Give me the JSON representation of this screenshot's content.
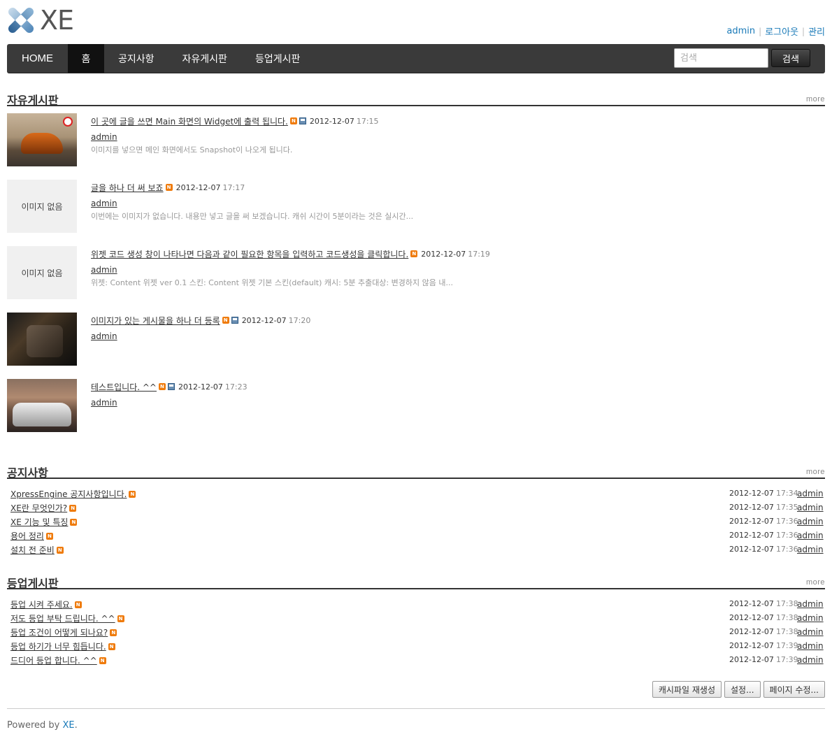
{
  "logo": {
    "text": "XE"
  },
  "account": {
    "admin": "admin",
    "logout": "로그아웃",
    "manage": "관리"
  },
  "gnb": {
    "items": [
      "HOME",
      "홈",
      "공지사항",
      "자유게시판",
      "등업게시판"
    ],
    "search_placeholder": "검색",
    "search_button": "검색"
  },
  "free_board": {
    "title": "자유게시판",
    "more": "more",
    "no_image": "이미지 없음",
    "items": [
      {
        "title": "이 곳에 글을 쓰면 Main 화면의 Widget에 출력 됩니다.",
        "date": "2012-12-07",
        "time": "17:15",
        "author": "admin",
        "summary": "이미지를 넣으면 메인 화면에서도 Snapshot이 나오게 됩니다."
      },
      {
        "title": "글을 하나 더 써 보죠",
        "date": "2012-12-07",
        "time": "17:17",
        "author": "admin",
        "summary": "이번에는 이미지가 없습니다. 내용만 넣고 글을 써 보겠습니다. 캐쉬 시간이 5분이라는 것은 실시간..."
      },
      {
        "title": "위젯 코드 생성 창이 나타나면 다음과 같이 필요한 항목을 입력하고 코드생성을 클릭합니다.",
        "date": "2012-12-07",
        "time": "17:19",
        "author": "admin",
        "summary": "위젯: Content 위젯 ver 0.1 스킨: Content 위젯 기본 스킨(default) 캐시: 5분 추출대상: 변경하지 않음 내..."
      },
      {
        "title": "이미지가 있는 게시물을 하나 더 등록",
        "date": "2012-12-07",
        "time": "17:20",
        "author": "admin",
        "summary": ""
      },
      {
        "title": "테스트입니다. ^^",
        "date": "2012-12-07",
        "time": "17:23",
        "author": "admin",
        "summary": ""
      }
    ]
  },
  "notice": {
    "title": "공지사항",
    "more": "more",
    "items": [
      {
        "title": "XpressEngine 공지사항입니다.",
        "date": "2012-12-07",
        "time": "17:34",
        "author": "admin"
      },
      {
        "title": "XE란 무엇인가?",
        "date": "2012-12-07",
        "time": "17:35",
        "author": "admin"
      },
      {
        "title": "XE 기능 및 특징",
        "date": "2012-12-07",
        "time": "17:36",
        "author": "admin"
      },
      {
        "title": "용어 정리",
        "date": "2012-12-07",
        "time": "17:36",
        "author": "admin"
      },
      {
        "title": "설치 전 준비",
        "date": "2012-12-07",
        "time": "17:36",
        "author": "admin"
      }
    ]
  },
  "levelup": {
    "title": "등업게시판",
    "more": "more",
    "items": [
      {
        "title": "등업 시켜 주세요.",
        "date": "2012-12-07",
        "time": "17:38",
        "author": "admin"
      },
      {
        "title": "저도 등업 부탁 드립니다. ^^",
        "date": "2012-12-07",
        "time": "17:38",
        "author": "admin"
      },
      {
        "title": "등업 조건이 어떻게 되나요?",
        "date": "2012-12-07",
        "time": "17:38",
        "author": "admin"
      },
      {
        "title": "등업 하기가 너무 힘듭니다.",
        "date": "2012-12-07",
        "time": "17:39",
        "author": "admin"
      },
      {
        "title": "드디어 등업 합니다. ^^",
        "date": "2012-12-07",
        "time": "17:39",
        "author": "admin"
      }
    ]
  },
  "buttons": {
    "regen_cache": "캐시파일 재생성",
    "settings": "설정...",
    "edit_page": "페이지 수정..."
  },
  "footer": {
    "prefix": "Powered by ",
    "link": "XE",
    "suffix": "."
  },
  "icons": {
    "new": "N",
    "new_color": "#ef7b0c",
    "image": "image-icon"
  }
}
